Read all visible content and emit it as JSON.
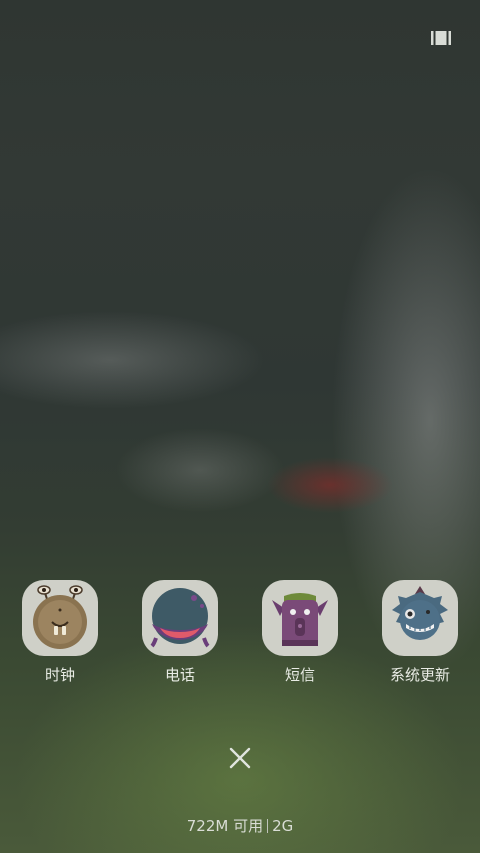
{
  "apps": [
    {
      "label": "时钟",
      "icon": "clock-monster-icon"
    },
    {
      "label": "电话",
      "icon": "phone-monster-icon"
    },
    {
      "label": "短信",
      "icon": "messages-monster-icon"
    },
    {
      "label": "系统更新",
      "icon": "system-update-monster-icon"
    }
  ],
  "status": {
    "memory": "722M 可用",
    "network": "2G"
  },
  "icons": {
    "recents": "recents-view-icon",
    "close": "close-icon"
  }
}
